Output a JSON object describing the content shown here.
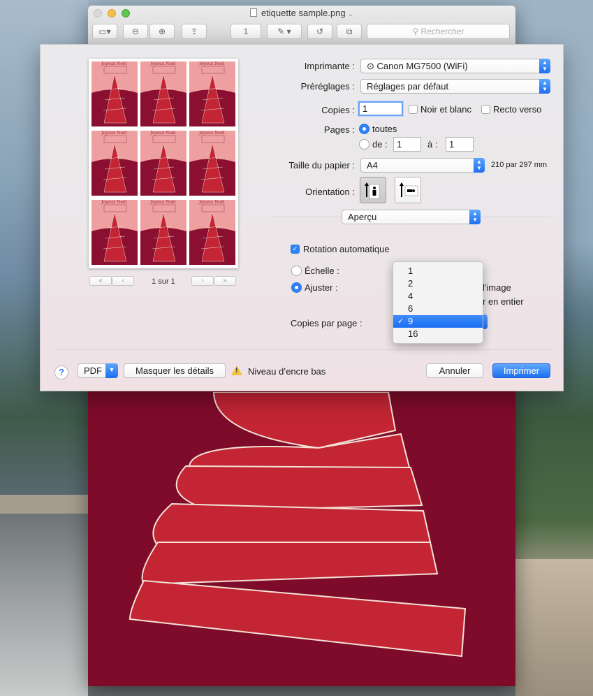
{
  "window": {
    "title": "etiquette sample.png",
    "page_field": "1",
    "search_placeholder": "Rechercher"
  },
  "preview": {
    "label_text": "Joyeux Noël",
    "page_indicator": "1 sur 1"
  },
  "print": {
    "printer_label": "Imprimante :",
    "printer_value": "Canon MG7500 (WiFi)",
    "presets_label": "Préréglages :",
    "presets_value": "Réglages par défaut",
    "copies_label": "Copies :",
    "copies_value": "1",
    "bw_label": "Noir et blanc",
    "duplex_label": "Recto verso",
    "pages_label": "Pages :",
    "pages_all": "toutes",
    "pages_from": "de :",
    "pages_from_value": "1",
    "pages_to": "à :",
    "pages_to_value": "1",
    "paper_label": "Taille du papier :",
    "paper_value": "A4",
    "paper_dims": "210 par 297 mm",
    "orientation_label": "Orientation :",
    "section_value": "Aperçu",
    "auto_rotate": "Rotation automatique",
    "scale_label": "Échelle :",
    "fit_label": "Ajuster :",
    "fit_option_a": "l'image",
    "fit_option_b": "r en entier",
    "copies_per_page_label": "Copies par page :",
    "copies_per_page_value": "9"
  },
  "copies_per_page_menu": {
    "options": [
      "1",
      "2",
      "4",
      "6",
      "9",
      "16"
    ],
    "selected": "9"
  },
  "footer": {
    "help": "?",
    "pdf": "PDF",
    "hide_details": "Masquer les détails",
    "ink_warning": "Niveau d’encre bas",
    "cancel": "Annuler",
    "print": "Imprimer"
  },
  "colors": {
    "accent": "#2e82f7",
    "label_bg": "#ee9f9f",
    "label_dark": "#8a0f30",
    "tree_red": "#c32534"
  }
}
